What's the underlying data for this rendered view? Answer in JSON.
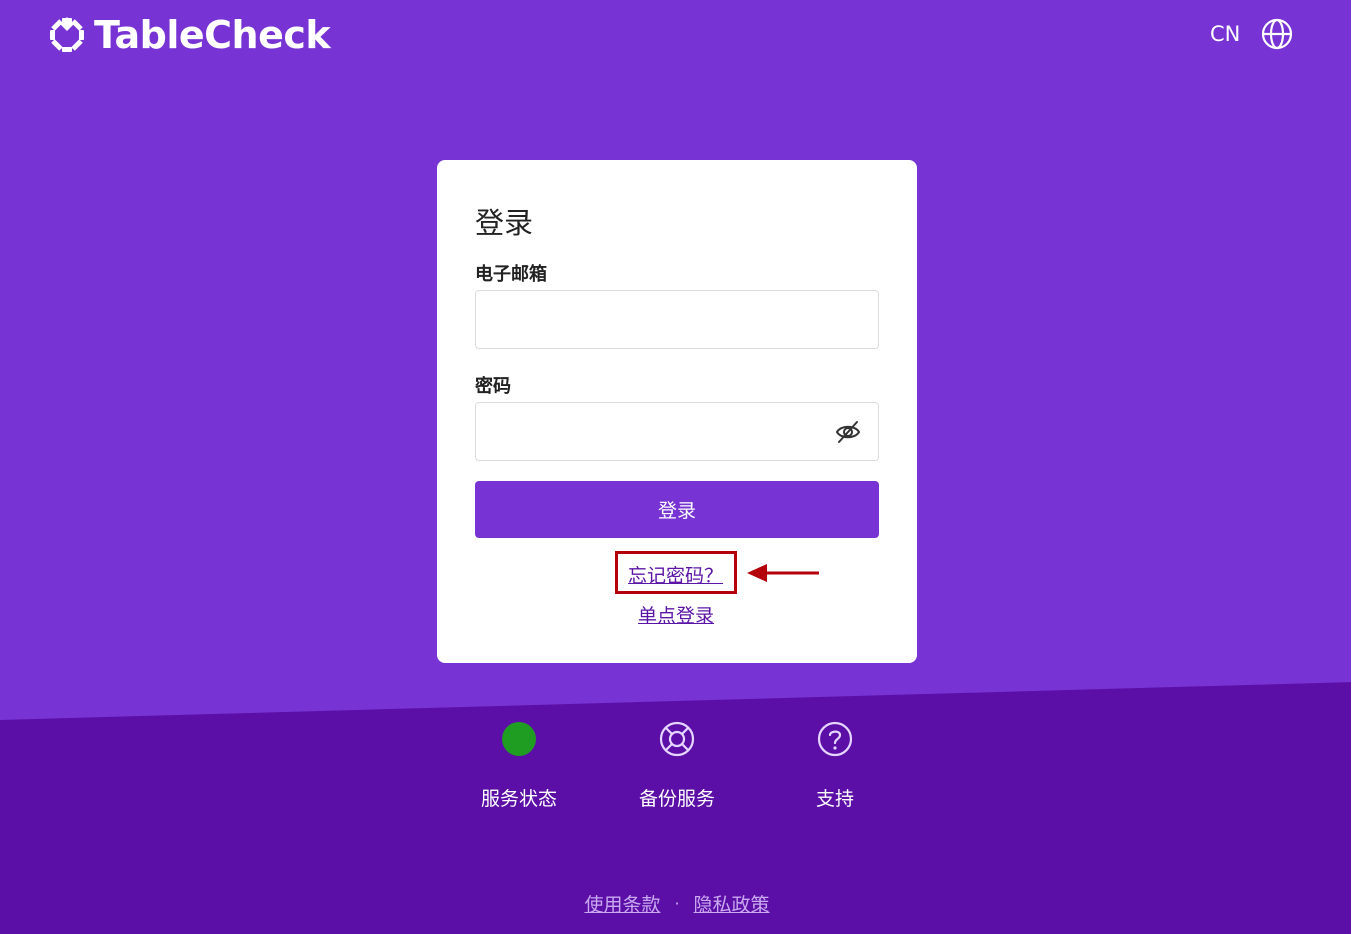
{
  "brand": {
    "name": "TableCheck"
  },
  "header": {
    "language": "CN",
    "language_icon": "globe-icon"
  },
  "login": {
    "title": "登录",
    "email_label": "电子邮箱",
    "email_value": "",
    "password_label": "密码",
    "password_value": "",
    "password_toggle_icon": "eye-slash-icon",
    "submit_label": "登录",
    "forgot_password": "忘记密码？",
    "sso_login": "单点登录"
  },
  "footer": {
    "items": [
      {
        "label": "服务状态",
        "icon": "status-dot-icon"
      },
      {
        "label": "备份服务",
        "icon": "lifebuoy-icon"
      },
      {
        "label": "支持",
        "icon": "question-circle-icon"
      }
    ],
    "terms": "使用条款",
    "separator": "·",
    "privacy": "隐私政策"
  },
  "colors": {
    "background": "#7733d4",
    "footer_background": "#5c0fa6",
    "primary_button": "#7733d4",
    "link": "#5a14a6",
    "status_ok": "#1f9d22",
    "highlight_box": "#b3000a",
    "annotation_arrow": "#b3000a"
  }
}
